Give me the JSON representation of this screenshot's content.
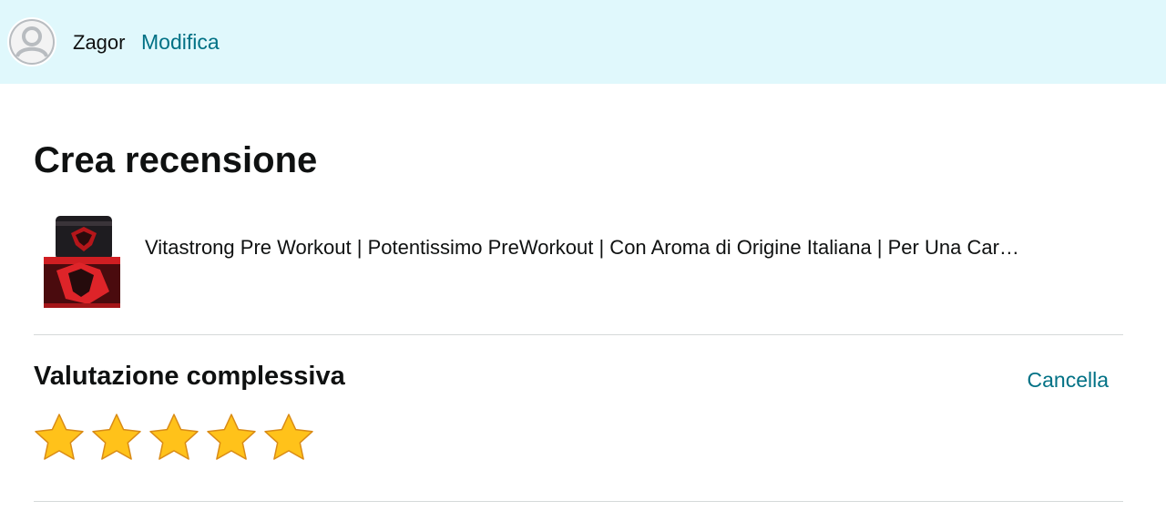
{
  "header": {
    "user_name": "Zagor",
    "edit_label": "Modifica",
    "avatar_icon": "user-avatar-icon"
  },
  "page": {
    "title": "Crea recensione"
  },
  "product": {
    "title": "Vitastrong Pre Workout | Potentissimo PreWorkout | Con Aroma di Origine Italiana | Per Una Car…",
    "image_icon": "product-image"
  },
  "rating": {
    "section_title": "Valutazione complessiva",
    "clear_label": "Cancella",
    "value": 5,
    "max": 5,
    "star_color": "#ffc21a"
  },
  "colors": {
    "header_bg": "#e0f8fc",
    "link": "#007185",
    "text": "#0f1111",
    "divider": "#d5d9d9"
  }
}
